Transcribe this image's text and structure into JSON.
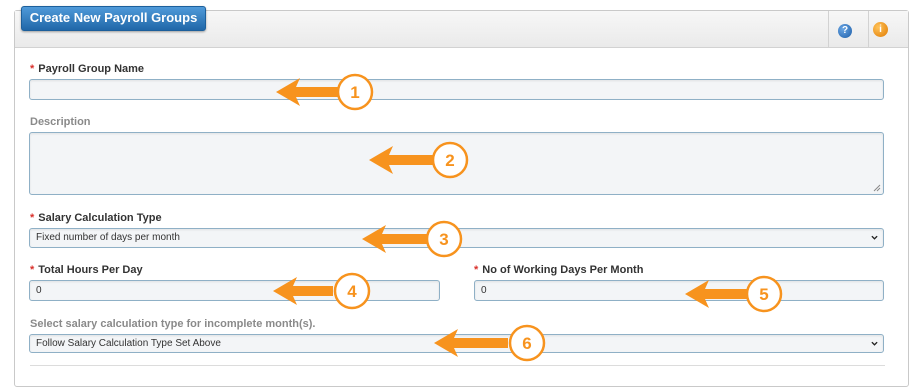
{
  "panel": {
    "title": "Create New Payroll Groups",
    "tools": [
      {
        "icon": "help-icon",
        "glyph": "?"
      },
      {
        "icon": "info-icon",
        "glyph": "i"
      }
    ]
  },
  "form": {
    "payroll_group_name": {
      "label": "Payroll Group Name",
      "required": true,
      "value": ""
    },
    "description": {
      "label": "Description",
      "required": false,
      "value": ""
    },
    "salary_calculation_type": {
      "label": "Salary Calculation Type",
      "required": true,
      "value": "Fixed number of days per month"
    },
    "total_hours_per_day": {
      "label": "Total Hours Per Day",
      "required": true,
      "value": "0"
    },
    "working_days_per_month": {
      "label": "No of Working Days Per Month",
      "required": true,
      "value": "0"
    },
    "incomplete_month_type": {
      "label": "Select salary calculation type for incomplete month(s).",
      "required": false,
      "value": "Follow Salary Calculation Type Set Above"
    }
  },
  "annotations": [
    "1",
    "2",
    "3",
    "4",
    "5",
    "6"
  ],
  "colors": {
    "accent_blue": "#2067a8",
    "required_star": "#d9302b",
    "annotation_orange": "#f7931e",
    "field_border": "#8fb0c6"
  }
}
